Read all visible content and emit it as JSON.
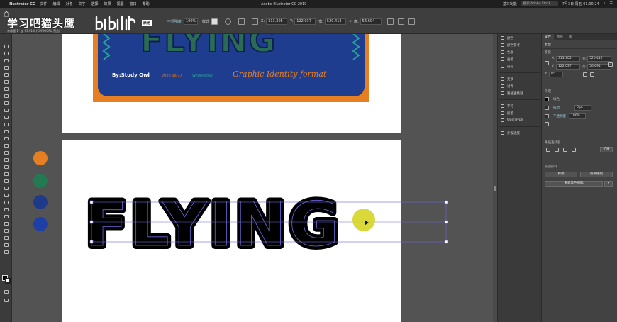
{
  "menubar": {
    "app_name": "Illustrator CC",
    "items": [
      "文件",
      "编辑",
      "对象",
      "文字",
      "选择",
      "效果",
      "视图",
      "窗口",
      "帮助"
    ],
    "window_title": "Adobe Illustrator CC 2019",
    "search_placeholder": "搜索 Adobe Stock",
    "workspace": "基本功能",
    "clock": "7月3日 周五 01:00:24"
  },
  "watermark": {
    "text": "学习吧猫头鹰",
    "sub": "未标题-1* @ 93.91% (CMYK/GPU 预览)",
    "logo_tag": "原创"
  },
  "controlbar": {
    "stroke_label": "不透明度",
    "opacity_value": "100%",
    "style_label": "样式",
    "x_value": "313.305",
    "y_value": "122.037",
    "w_value": "520.412",
    "h_value": "56.694"
  },
  "colors": {
    "accent_orange": "#e67e22",
    "accent_green": "#217a52",
    "accent_navy": "#1e3a8a",
    "accent_blue": "#1f3fa8",
    "cursor_highlight": "#d6d628"
  },
  "canvas": {
    "poster_title": "FLYING",
    "poster_by": "By:Study Owl",
    "poster_date": "2020 06/17",
    "poster_day": "Wednesday",
    "poster_script": "Graphic Identity format",
    "flying_text": "FLYING",
    "swatches": [
      "#e67e22",
      "#217a52",
      "#1e3a8a",
      "#1f3fa8"
    ]
  },
  "iconcol": {
    "rows": [
      "颜色",
      "颜色参考",
      "色板",
      "画笔",
      "符号",
      "变换",
      "对齐",
      "路径查找器",
      "字符",
      "段落",
      "OpenType",
      "外观透底"
    ]
  },
  "properties": {
    "tabs": [
      "属性",
      "图层",
      "库"
    ],
    "section_group": "复合",
    "section_transform": "变换",
    "x": "313.305",
    "y": "122.037",
    "w": "520.412",
    "h": "56.694",
    "angle": "0°",
    "section_appearance": "外观",
    "fill_label": "填色",
    "stroke_label": "描边",
    "stroke_value": "0 pt",
    "opacity_label": "不透明度",
    "opacity_value": "100%",
    "section_pathfinder": "路径查找器",
    "expand_label": "扩展",
    "section_quick": "快速操作",
    "btn_expand": "释放",
    "btn_isolate": "隔离编组",
    "btn_recolor": "重新着色图稿"
  }
}
